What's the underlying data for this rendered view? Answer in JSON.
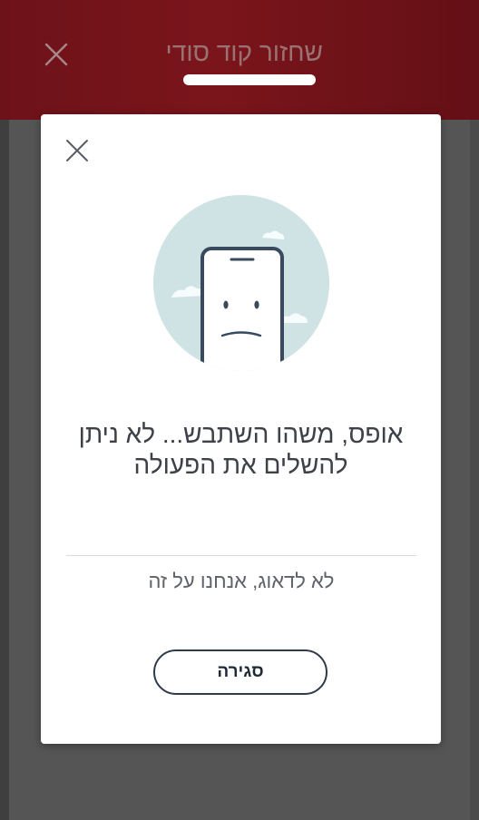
{
  "background_screen": {
    "title": "שחזור קוד סודי",
    "close_icon": "close-icon",
    "header_color": "#7a151b"
  },
  "dialog": {
    "close_icon": "close-icon",
    "illustration": "sad-phone-icon",
    "title": "אופס, משהו השתבש... לא ניתן להשלים את הפעולה",
    "subtitle": "לא לדאוג, אנחנו על זה",
    "close_button_label": "סגירה",
    "colors": {
      "illustration_circle": "#cfe3e5",
      "phone_outline": "#3a4a5e",
      "button_border": "#2f3b4a"
    }
  }
}
